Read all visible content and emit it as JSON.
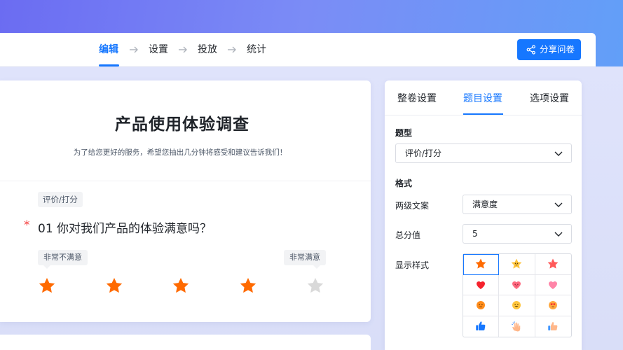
{
  "steps": [
    {
      "label": "编辑",
      "active": true
    },
    {
      "label": "设置",
      "active": false
    },
    {
      "label": "投放",
      "active": false
    },
    {
      "label": "统计",
      "active": false
    }
  ],
  "share_button": {
    "label": "分享问卷",
    "icon": "share-icon"
  },
  "survey": {
    "title": "产品使用体验调查",
    "description": "为了给您更好的服务，希望您抽出几分钟将感受和建议告诉我们！",
    "question": {
      "type_tag": "评价/打分",
      "required_mark": "*",
      "text": "01 你对我们产品的体验满意吗？",
      "low_label": "非常不满意",
      "high_label": "非常满意",
      "rating": {
        "selected": 4,
        "max": 5
      },
      "colors": {
        "filled": "#ff6a00",
        "empty": "#d9d9d9"
      }
    }
  },
  "panel": {
    "tabs": [
      {
        "label": "整卷设置",
        "active": false
      },
      {
        "label": "题目设置",
        "active": true
      },
      {
        "label": "选项设置",
        "active": false
      }
    ],
    "question_type_section": "题型",
    "question_type_value": "评价/打分",
    "format_section": "格式",
    "fields": {
      "two_level_label": "两级文案",
      "two_level_value": "满意度",
      "total_score_label": "总分值",
      "total_score_value": "5",
      "display_style_label": "显示样式"
    },
    "styles": [
      "star-icon",
      "smiling-star-icon",
      "sparkle-star-icon",
      "heart-icon",
      "smiling-heart-icon",
      "pink-heart-icon",
      "neutral-face-icon",
      "grin-face-icon",
      "heart-eyes-face-icon",
      "thumbs-up-icon",
      "clapping-hands-icon",
      "thumbs-up-hand-icon"
    ],
    "selected_style": "star-icon"
  },
  "colors": {
    "accent": "#1677ff",
    "star": "#ff6a00",
    "required": "#f53f3f"
  }
}
